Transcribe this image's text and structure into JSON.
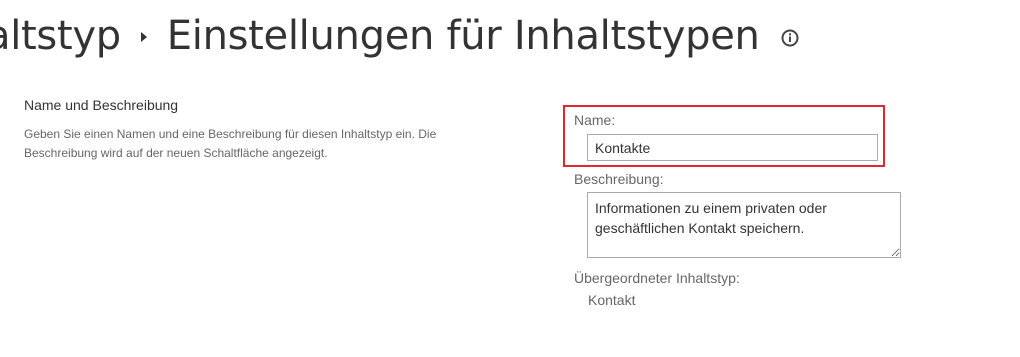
{
  "header": {
    "breadcrumb_parent": "altstyp",
    "title": "Einstellungen für Inhaltstypen",
    "separator_icon": "chevron-right-icon",
    "info_icon": "info-icon"
  },
  "section": {
    "title": "Name und Beschreibung",
    "description": "Geben Sie einen Namen und eine Beschreibung für diesen Inhaltstyp ein. Die Beschreibung wird auf der neuen Schaltfläche angezeigt."
  },
  "form": {
    "name_label": "Name:",
    "name_value": "Kontakte",
    "description_label": "Beschreibung:",
    "description_value": "Informationen zu einem privaten oder geschäftlichen Kontakt speichern.",
    "parent_label": "Übergeordneter Inhaltstyp:",
    "parent_value": "Kontakt"
  },
  "colors": {
    "highlight": "#e3272a",
    "text": "#333333",
    "muted_text": "#666666",
    "input_border": "#ababab"
  }
}
